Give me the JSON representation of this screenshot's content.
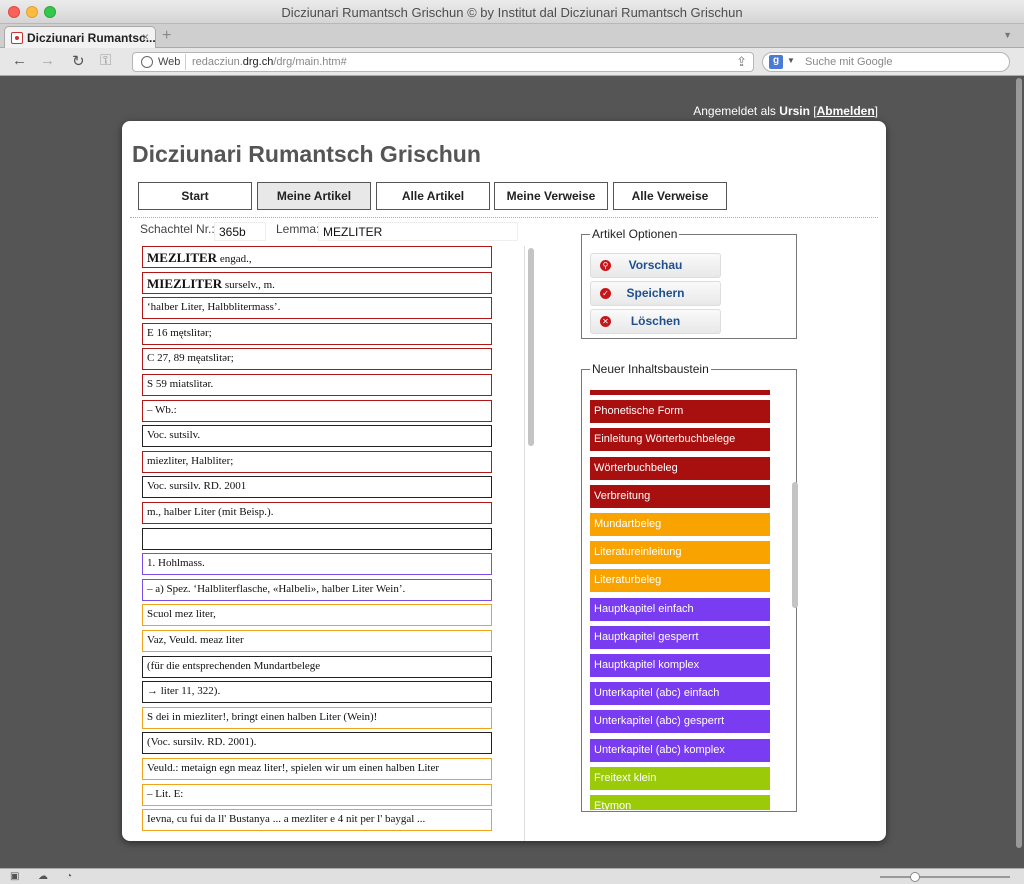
{
  "window": {
    "title": "Dicziunari Rumantsch Grischun © by Institut dal Dicziunari Rumantsch Grischun",
    "tab_title": "Dicziunari Rumantsc...",
    "tab_close": "×",
    "new_tab": "+",
    "tab_dropdown": "▼"
  },
  "toolbar": {
    "back": "←",
    "forward": "→",
    "reload": "↻",
    "key": "⚿",
    "web_label": "Web",
    "url_prefix": "redacziun.",
    "url_domain": "drg.ch",
    "url_path": "/drg/main.htm#",
    "share": "⇪",
    "search_engine": "g",
    "search_caret": "▼",
    "search_placeholder": "Suche mit Google"
  },
  "login": {
    "prefix": "Angemeldet als ",
    "user": "Ursin",
    "open": " [",
    "logout": "Abmelden",
    "close": "]"
  },
  "app": {
    "title": "Dicziunari Rumantsch Grischun",
    "menu": [
      {
        "label": "Start"
      },
      {
        "label": "Meine Artikel"
      },
      {
        "label": "Alle Artikel"
      },
      {
        "label": "Meine Verweise"
      },
      {
        "label": "Alle Verweise"
      }
    ],
    "schachtel_label": "Schachtel Nr.:",
    "schachtel_value": "365b",
    "lemma_label": "Lemma:",
    "lemma_value": "MEZLITER"
  },
  "entries": [
    {
      "color": "red",
      "main": "MEZLITER",
      "rest": " engad.,"
    },
    {
      "color": "red",
      "main": "MIEZLITER",
      "rest": " surselv., m."
    },
    {
      "color": "red",
      "main": "",
      "rest": "‘halber Liter, Halbblitermass’."
    },
    {
      "color": "red",
      "main": "",
      "rest": "E 16 mętslìtər;"
    },
    {
      "color": "red",
      "main": "",
      "rest": "C 27, 89 męatslìtər;"
    },
    {
      "color": "red",
      "main": "",
      "rest": "S 59 miatslìtər."
    },
    {
      "color": "red",
      "main": "",
      "rest": "– Wb.:"
    },
    {
      "color": "black",
      "main": "",
      "rest": "Voc. sutsilv."
    },
    {
      "color": "red",
      "main": "",
      "rest": "miezliter, Halbliter;"
    },
    {
      "color": "black",
      "main": "",
      "rest": "Voc. sursilv. RD. 2001"
    },
    {
      "color": "red",
      "main": "",
      "rest": "m., halber Liter (mit Beisp.)."
    },
    {
      "color": "black",
      "main": "",
      "rest": ""
    },
    {
      "color": "purple",
      "main": "",
      "rest": "1. Hohlmass."
    },
    {
      "color": "purple",
      "main": "",
      "rest": "– a) Spez. ‘Halbliterflasche, «Halbeli», halber Liter Wein’."
    },
    {
      "color": "orange",
      "main": "",
      "rest": "Scuol mez liter,"
    },
    {
      "color": "orange",
      "main": "",
      "rest": "Vaz, Veuld. meaz liter"
    },
    {
      "color": "black",
      "main": "",
      "rest": "(für die entsprechenden Mundartbelege"
    },
    {
      "color": "black",
      "main": "",
      "rest": "→ liter 11, 322)."
    },
    {
      "color": "orange",
      "main": "",
      "rest": "S dei in miezliter!, bringt einen halben Liter (Wein)!"
    },
    {
      "color": "black",
      "main": "",
      "rest": "(Voc. sursilv. RD. 2001)."
    },
    {
      "color": "orange",
      "main": "",
      "rest": "Veuld.: metaign egn meaz liter!, spielen wir um einen halben Liter"
    },
    {
      "color": "orange",
      "main": "",
      "rest": "– Lit. E:"
    },
    {
      "color": "orange",
      "main": "",
      "rest": "Ievna, cu fui da ll' Bustanya ... a mezliter e 4 nit per l' baygal ..."
    }
  ],
  "options": {
    "legend": "Artikel Optionen",
    "buttons": [
      {
        "label": "Vorschau",
        "icon": "⚲"
      },
      {
        "label": "Speichern",
        "icon": "✓"
      },
      {
        "label": "Löschen",
        "icon": "✕"
      }
    ]
  },
  "blocks": {
    "legend": "Neuer Inhaltsbaustein",
    "items": [
      {
        "label": "",
        "color": "#a80f0f"
      },
      {
        "label": "Phonetische Form",
        "color": "#a80f0f"
      },
      {
        "label": "Einleitung Wörterbuchbelege",
        "color": "#a80f0f"
      },
      {
        "label": "Wörterbuchbeleg",
        "color": "#a80f0f"
      },
      {
        "label": "Verbreitung",
        "color": "#a80f0f"
      },
      {
        "label": "Mundartbeleg",
        "color": "#f9a300"
      },
      {
        "label": "Literatureinleitung",
        "color": "#f9a300"
      },
      {
        "label": "Literaturbeleg",
        "color": "#f9a300"
      },
      {
        "label": "Hauptkapitel einfach",
        "color": "#7a3cf0"
      },
      {
        "label": "Hauptkapitel gesperrt",
        "color": "#7a3cf0"
      },
      {
        "label": "Hauptkapitel komplex",
        "color": "#7a3cf0"
      },
      {
        "label": "Unterkapitel (abc) einfach",
        "color": "#7a3cf0"
      },
      {
        "label": "Unterkapitel (abc) gesperrt",
        "color": "#7a3cf0"
      },
      {
        "label": "Unterkapitel (abc) komplex",
        "color": "#7a3cf0"
      },
      {
        "label": "Freitext klein",
        "color": "#9bcb08"
      },
      {
        "label": "Etymon",
        "color": "#9bcb08"
      }
    ]
  }
}
